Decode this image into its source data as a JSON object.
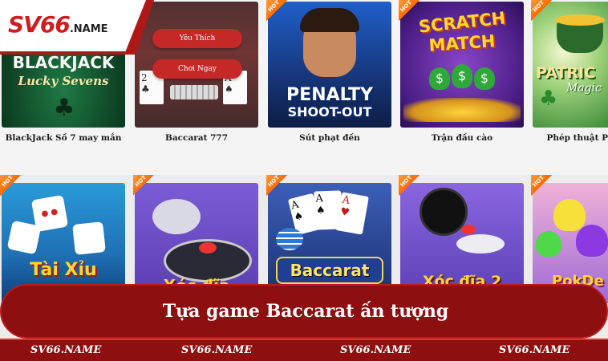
{
  "logo": {
    "brand": "SV66",
    "suffix": ".NAME"
  },
  "overlay_buttons": {
    "like": "Yêu Thích",
    "play_now": "Chơi Ngay"
  },
  "hot_badge": "HOT",
  "games_row1": [
    {
      "name": "BlackJack Số 7 may mắn",
      "art_text": "BLACKJACK",
      "art_sub": "Lucky Sevens"
    },
    {
      "name": "Baccarat 777"
    },
    {
      "name": "Sút phạt đền",
      "art_text": "PENALTY",
      "art_sub": "SHOOT-OUT"
    },
    {
      "name": "Trận đấu cào",
      "art_text": "SCRATCH",
      "art_sub": "MATCH"
    },
    {
      "name": "Phép thuật P",
      "art_text": "PATRIC",
      "art_sub": "Magic"
    }
  ],
  "games_row2": [
    {
      "art_text": "Tài Xỉu"
    },
    {
      "art_text": "Xóc đĩa"
    },
    {
      "art_text": "Baccarat"
    },
    {
      "art_text": "Xóc đĩa 2"
    },
    {
      "art_text": "PokDe"
    }
  ],
  "banner": {
    "title": "Tựa game Baccarat ấn tượng"
  },
  "watermarks": [
    "SV66.NAME",
    "SV66.NAME",
    "SV66.NAME",
    "SV66.NAME"
  ],
  "colors": {
    "brand_red": "#8e0f0f",
    "hot_orange": "#ff7a1a"
  }
}
